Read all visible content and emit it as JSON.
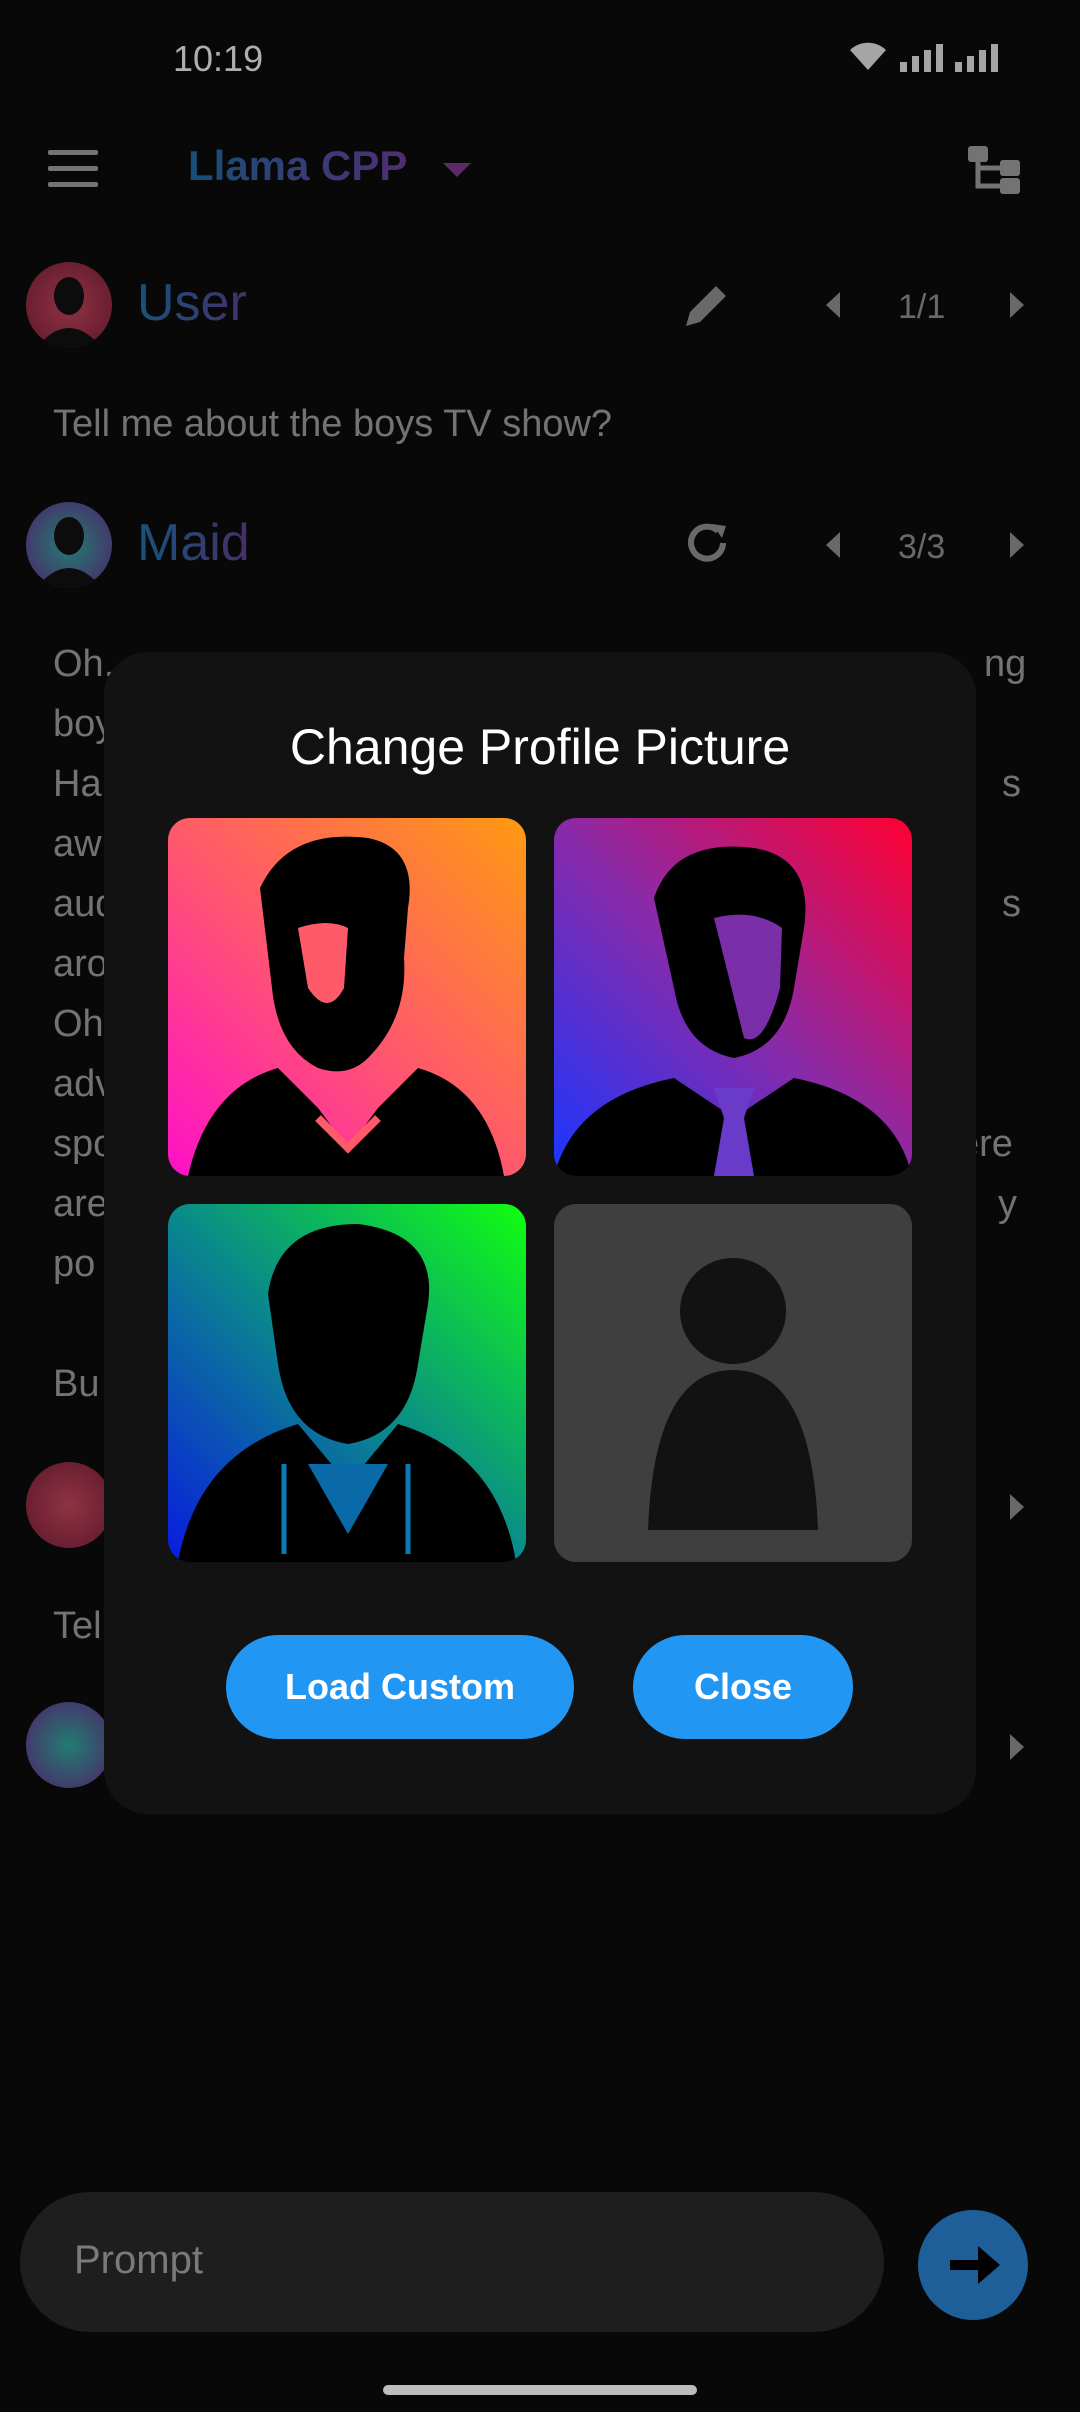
{
  "status_bar": {
    "time": "10:19"
  },
  "app_bar": {
    "title": "Llama CPP"
  },
  "messages": [
    {
      "sender": "User",
      "text": "Tell me about the boys TV show?",
      "nav": "1/1"
    },
    {
      "sender": "Maid",
      "nav": "3/3",
      "lines": [
        "Oh, ...",
        "boy",
        "Ha",
        "aw",
        "aud",
        "aro",
        "Oh",
        "adv",
        "spo",
        "are",
        "po",
        "",
        "Bu"
      ],
      "right_fragments": [
        "ng",
        "s",
        "s",
        "ere",
        "y"
      ]
    },
    {
      "sender": "",
      "text": "Tel"
    }
  ],
  "dialog": {
    "title": "Change Profile Picture",
    "load_custom_label": "Load Custom",
    "close_label": "Close"
  },
  "prompt": {
    "placeholder": "Prompt"
  },
  "colors": {
    "accent": "#2196f3",
    "background": "#0b0b0b",
    "dialog": "#121212"
  }
}
